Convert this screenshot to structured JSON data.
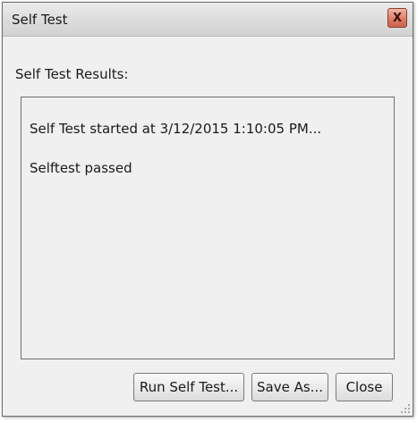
{
  "window": {
    "title": "Self Test",
    "close_glyph": "X"
  },
  "results": {
    "label": "Self Test Results:",
    "lines": [
      "Self Test started at 3/12/2015 1:10:05 PM...",
      "Selftest passed"
    ]
  },
  "buttons": {
    "run_label": "Run Self Test...",
    "save_label": "Save As...",
    "close_label": "Close"
  },
  "icons": {
    "close": "close-icon",
    "resize": "resize-grip-icon"
  },
  "colors": {
    "dialog_bg": "#f0f0f0",
    "close_button": "#d97a63",
    "text": "#1a1a1a"
  }
}
